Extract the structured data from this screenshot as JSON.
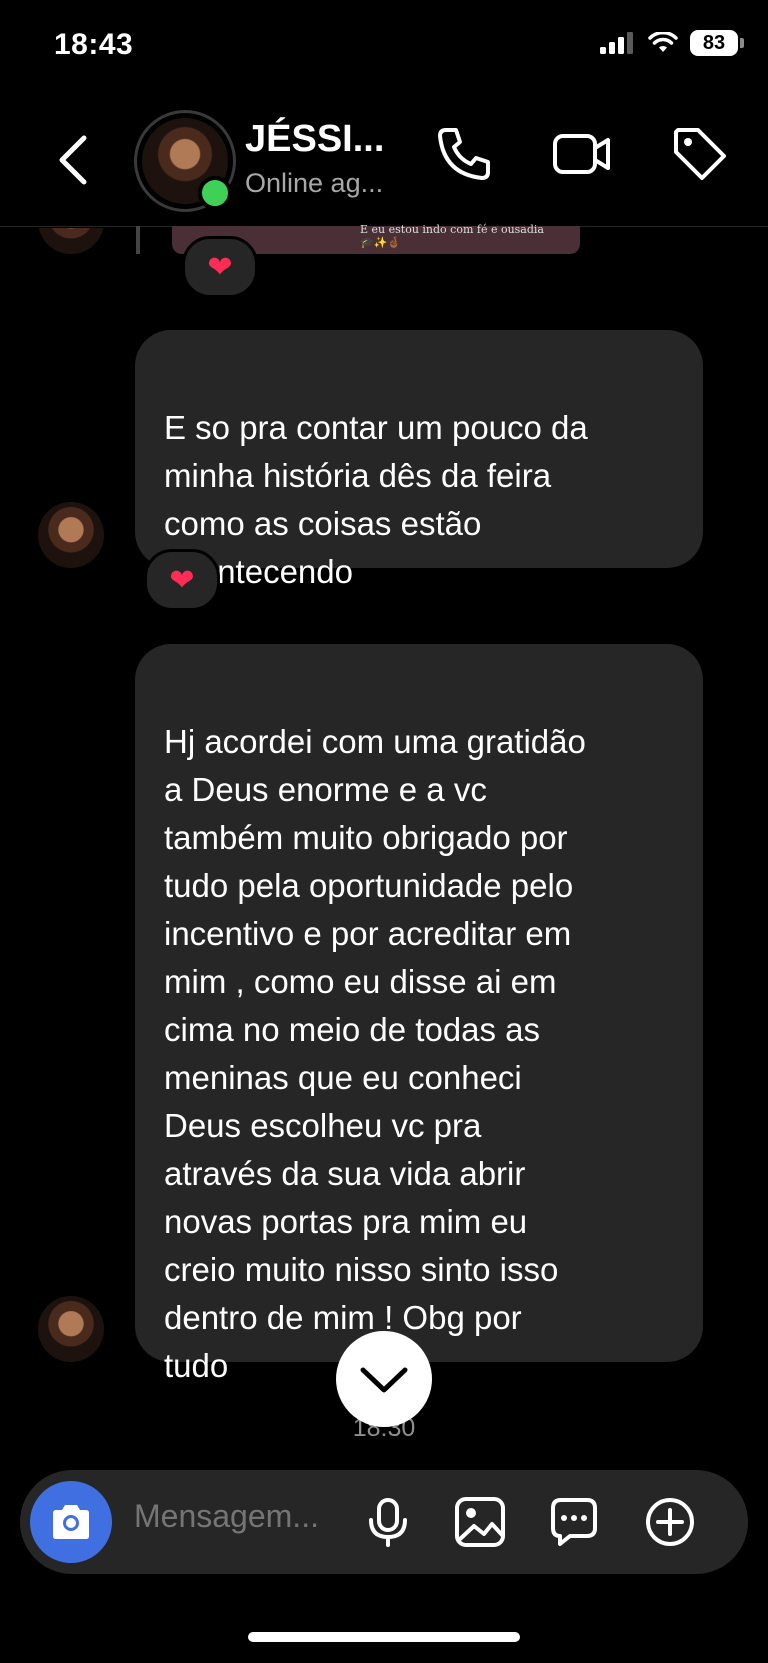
{
  "status_bar": {
    "time": "18:43",
    "battery": "83"
  },
  "header": {
    "contact_name": "JÉSSI...",
    "contact_status": "Online ag..."
  },
  "previous_media": {
    "caption": "E eu estou indo com fé e ousadia",
    "emojis": "🎓✨🤞🏾"
  },
  "messages": [
    {
      "text": "E so pra contar um pouco da\nminha história dês da feira\ncomo as coisas estão\nacontecendo",
      "reaction": "❤"
    },
    {
      "text": "Hj acordei com uma gratidão\na Deus enorme e a vc\ntambém muito obrigado por\ntudo pela oportunidade pelo\nincentivo e por acreditar em\nmim , como eu disse ai em\ncima no meio de todas as\nmeninas que eu conheci\nDeus escolheu vc pra\natravés da sua vida abrir\nnovas portas pra mim eu\ncreio muito nisso sinto isso\ndentro de mim ! Obg por\ntudo"
    }
  ],
  "prev_reaction": "❤",
  "timestamp": "18:30",
  "composer": {
    "placeholder": "Mensagem..."
  },
  "colors": {
    "bubble": "#262626",
    "online": "#3fd058",
    "camera_button": "#3f6fe0",
    "reaction_heart": "#ff2d55"
  },
  "icons": [
    "chevron-left-icon",
    "phone-icon",
    "video-icon",
    "tag-icon",
    "camera-icon",
    "microphone-icon",
    "gallery-icon",
    "sticker-icon",
    "plus-icon",
    "chevron-down-icon"
  ]
}
